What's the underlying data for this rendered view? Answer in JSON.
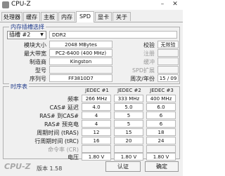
{
  "window": {
    "title": "CPU-Z",
    "minimize": "–",
    "close": "✕",
    "icon": "cpu-z-logo-icon"
  },
  "tabs": [
    {
      "label": "处理器"
    },
    {
      "label": "缓存"
    },
    {
      "label": "主板"
    },
    {
      "label": "内存"
    },
    {
      "label": "SPD",
      "active": true
    },
    {
      "label": "显卡"
    },
    {
      "label": "关于"
    }
  ],
  "slot_group": {
    "title": "内存插槽选择",
    "slot_select": "插槽 #2",
    "type": "DDR2",
    "labels": {
      "module_size": "模块大小",
      "max_bandwidth": "最大带宽",
      "manufacturer": "制造商",
      "part_number": "型号",
      "serial": "序列号",
      "correction": "校验",
      "registered": "注册",
      "buffered": "缓冲",
      "spd_ext": "SPD扩展",
      "week_year": "周次/年份"
    },
    "values": {
      "module_size": "2048 MBytes",
      "max_bandwidth": "PC2-6400 (400 MHz)",
      "manufacturer": "Kingston",
      "part_number": "",
      "serial": "FF3810D7",
      "correction": "无效验",
      "registered": "",
      "buffered": "",
      "spd_ext": "",
      "week_year": "15 / 09"
    }
  },
  "timings_group": {
    "title": "时序表",
    "columns": [
      "JEDEC #1",
      "JEDEC #2",
      "JEDEC #3"
    ],
    "rows": [
      {
        "label": "频率",
        "values": [
          "266 MHz",
          "333 MHz",
          "400 MHz"
        ]
      },
      {
        "label": "CAS# 延迟",
        "values": [
          "4.0",
          "5.0",
          "6.0"
        ]
      },
      {
        "label": "RAS# 到CAS#",
        "values": [
          "4",
          "5",
          "6"
        ]
      },
      {
        "label": "RAS# 预充电",
        "values": [
          "4",
          "5",
          "6"
        ]
      },
      {
        "label": "周期时间 (tRAS)",
        "values": [
          "12",
          "15",
          "18"
        ]
      },
      {
        "label": "行周期时间 (tRC)",
        "values": [
          "16",
          "20",
          "24"
        ]
      },
      {
        "label": "命令率 (CR)",
        "values": [
          "",
          "",
          ""
        ]
      },
      {
        "label": "电压",
        "values": [
          "1.80 V",
          "1.80 V",
          "1.80 V"
        ]
      }
    ]
  },
  "footer": {
    "brand": "CPU-Z",
    "version": "版本 1.58",
    "ok_label": "认证",
    "confirm_label": "确定"
  }
}
